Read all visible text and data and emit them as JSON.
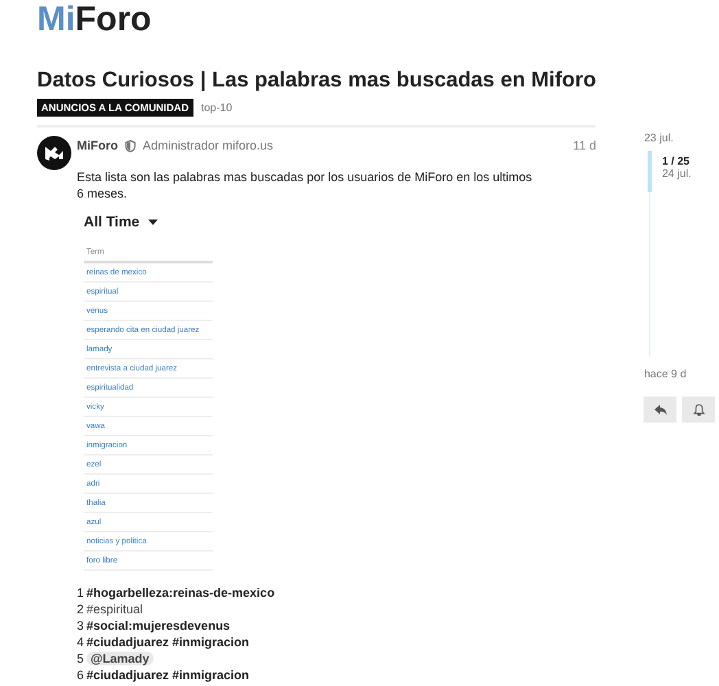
{
  "logo": {
    "first": "Mi",
    "second": "Foro"
  },
  "topic": {
    "title": "Datos Curiosos | Las palabras mas buscadas en Miforo",
    "category": "ANUNCIOS A LA COMUNIDAD",
    "tags": [
      "top-10"
    ]
  },
  "post": {
    "author": "MiForo",
    "role": "Administrador miforo.us",
    "age": "11 d",
    "body": "Esta lista son las palabras mas buscadas por los usuarios de MiForo en los ultimos 6 meses.",
    "period": "All Time",
    "table": {
      "column": "Term",
      "rows": [
        "reinas de mexico",
        "espiritual",
        "venus",
        "esperando cita en ciudad juarez",
        "lamady",
        "entrevista a ciudad juarez",
        "espiritualidad",
        "vicky",
        "vawa",
        "inmigracion",
        "ezel",
        "adri",
        "thalia",
        "azul",
        "noticias y politica",
        "foro libre"
      ]
    },
    "list": [
      {
        "number": "1",
        "text": "#hogarbelleza:reinas-de-mexico",
        "kind": "tag"
      },
      {
        "number": "2",
        "text": "#espiritual",
        "kind": "plain"
      },
      {
        "number": "3",
        "text": "#social:mujeresdevenus",
        "kind": "tag"
      },
      {
        "number": "4",
        "text": "#ciudadjuarez #inmigracion",
        "kind": "tag"
      },
      {
        "number": "5",
        "text": "@Lamady",
        "kind": "mention"
      },
      {
        "number": "6",
        "text": "#ciudadjuarez #inmigracion",
        "kind": "tag"
      }
    ]
  },
  "timeline": {
    "start": "23 jul.",
    "position": "1 / 25",
    "current": "24 jul.",
    "level": 0.2,
    "end": "hace 9 d"
  }
}
